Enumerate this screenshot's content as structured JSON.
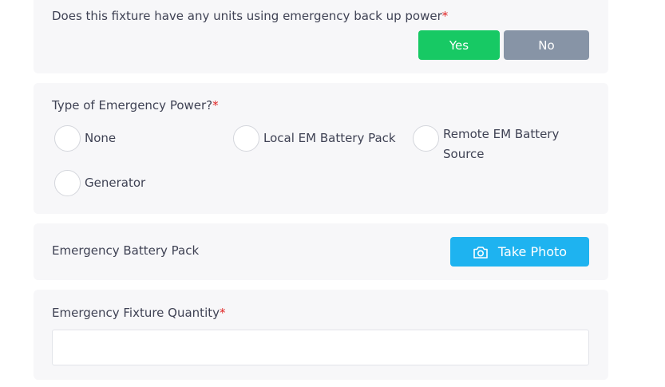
{
  "backup_power": {
    "question": "Does this fixture have any units using emergency back up power",
    "required_mark": "*",
    "yes_label": "Yes",
    "no_label": "No"
  },
  "emergency_power_type": {
    "question": "Type of Emergency Power?",
    "required_mark": "*",
    "options": [
      {
        "label": "None"
      },
      {
        "label": "Local EM Battery Pack"
      },
      {
        "label": "Remote EM Battery Source"
      },
      {
        "label": "Generator"
      }
    ]
  },
  "battery_pack": {
    "label": "Emergency Battery Pack",
    "photo_button_label": "Take Photo",
    "photo_icon": "camera-icon"
  },
  "fixture_quantity": {
    "label": "Emergency Fixture Quantity",
    "required_mark": "*",
    "value": "",
    "placeholder": ""
  },
  "colors": {
    "yes_button": "#17c964",
    "no_button": "#8794a6",
    "photo_button": "#1eb3f0",
    "required": "#e02424",
    "card_background": "#f7f7f9"
  }
}
